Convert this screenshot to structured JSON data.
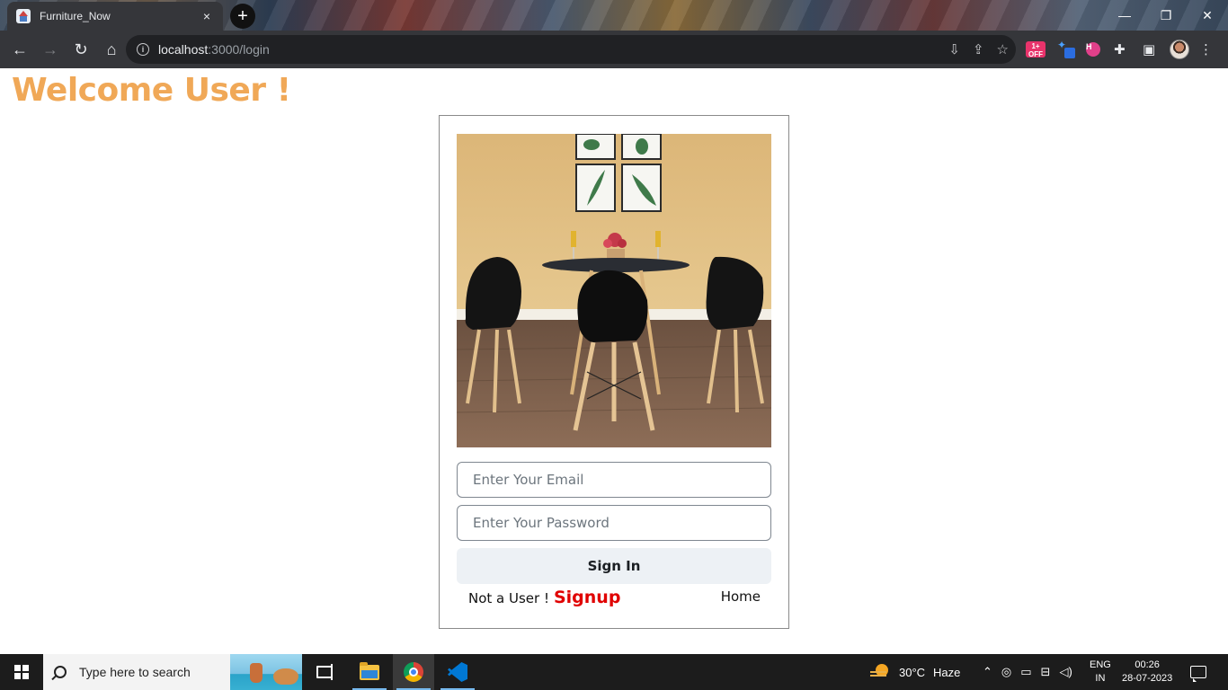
{
  "browser": {
    "tab_title": "Furniture_Now",
    "tab_close": "×",
    "new_tab": "+",
    "url_host": "localhost",
    "url_path": ":3000/login",
    "minimize": "—",
    "maximize": "❐",
    "close": "✕"
  },
  "extensions": {
    "off_badge": "1+ OFF",
    "pink_badge": "H"
  },
  "page": {
    "welcome": "Welcome User !",
    "login": {
      "image_alt": "Dining table with three black chairs",
      "email_placeholder": "Enter Your Email",
      "password_placeholder": "Enter Your Password",
      "signin_label": "Sign In",
      "not_user_text": "Not a User !",
      "signup_link": "Signup",
      "home_link": "Home"
    }
  },
  "taskbar": {
    "search_placeholder": "Type here to search",
    "weather_temp": "30°C",
    "weather_desc": "Haze",
    "lang_top": "ENG",
    "lang_bottom": "IN",
    "time": "00:26",
    "date": "28-07-2023"
  },
  "colors": {
    "welcome": "#f0a857",
    "signup": "#e00000",
    "chrome_dark": "#35363a"
  }
}
